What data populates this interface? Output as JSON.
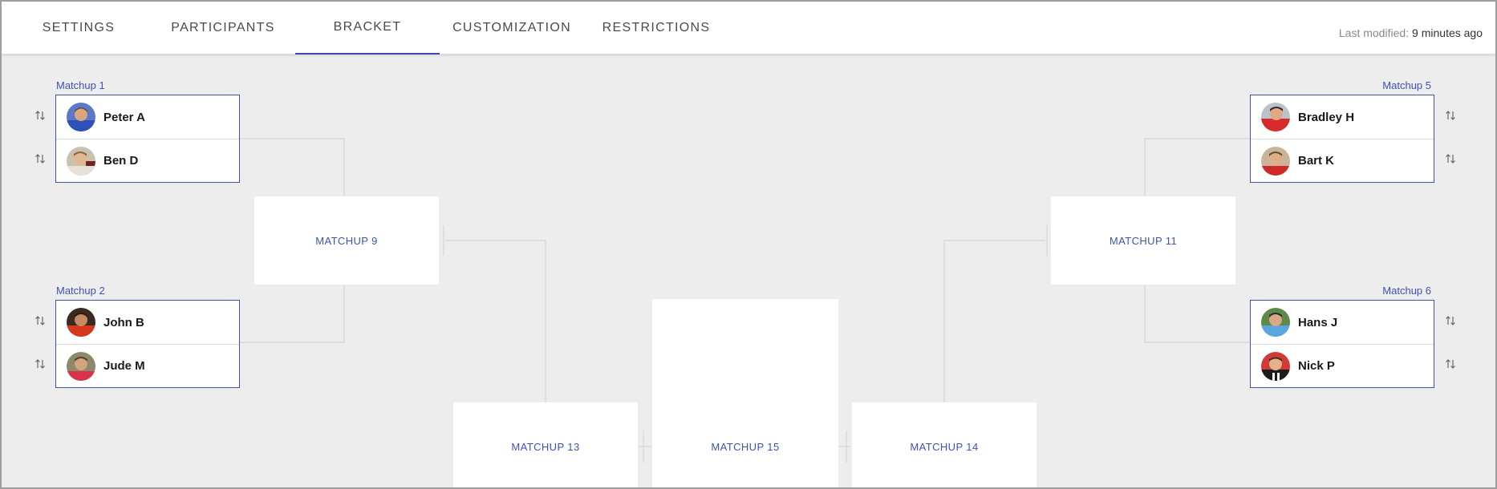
{
  "tabs": [
    {
      "label": "SETTINGS"
    },
    {
      "label": "PARTICIPANTS"
    },
    {
      "label": "BRACKET"
    },
    {
      "label": "CUSTOMIZATION"
    },
    {
      "label": "RESTRICTIONS"
    }
  ],
  "active_tab": "BRACKET",
  "last_modified": {
    "label": "Last modified:",
    "value": "9 minutes ago"
  },
  "matchups": {
    "m1": {
      "label": "Matchup 1",
      "players": [
        {
          "name": "Peter A"
        },
        {
          "name": "Ben D"
        }
      ]
    },
    "m2": {
      "label": "Matchup 2",
      "players": [
        {
          "name": "John B"
        },
        {
          "name": "Jude M"
        }
      ]
    },
    "m5": {
      "label": "Matchup 5",
      "players": [
        {
          "name": "Bradley H"
        },
        {
          "name": "Bart K"
        }
      ]
    },
    "m6": {
      "label": "Matchup 6",
      "players": [
        {
          "name": "Hans J"
        },
        {
          "name": "Nick P"
        }
      ]
    }
  },
  "pending": {
    "m9": "MATCHUP 9",
    "m11": "MATCHUP 11",
    "m13": "MATCHUP 13",
    "m14": "MATCHUP 14",
    "m15": "MATCHUP 15"
  },
  "colors": {
    "accent": "#3f51b5",
    "background": "#ededed",
    "connector": "#d6d6d6"
  },
  "icons": {
    "swap": "swap-vertical-icon"
  }
}
